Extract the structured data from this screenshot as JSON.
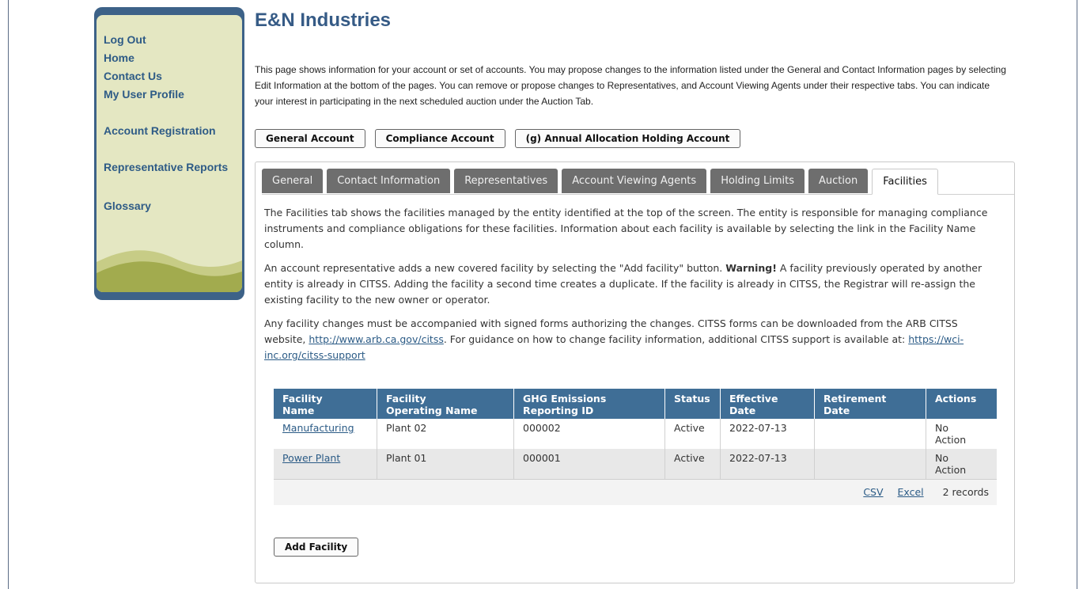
{
  "sidebar": {
    "links": [
      "Log Out",
      "Home",
      "Contact Us",
      "My User Profile"
    ],
    "account_registration": "Account Registration",
    "representative_reports": "Representative Reports",
    "glossary": "Glossary"
  },
  "main": {
    "title": "E&N Industries",
    "intro": "This page shows information for your account or set of accounts. You may propose changes to the information listed under the General and Contact Information pages by selecting Edit Information at the bottom of the pages. You can remove or propose changes to Representatives, and Account Viewing Agents under their respective tabs. You can indicate your interest in participating in the next scheduled auction under the Auction Tab.",
    "account_buttons": [
      "General Account",
      "Compliance Account",
      "(g) Annual Allocation Holding Account"
    ]
  },
  "tabs": [
    "General",
    "Contact Information",
    "Representatives",
    "Account Viewing Agents",
    "Holding Limits",
    "Auction",
    "Facilities"
  ],
  "active_tab": "Facilities",
  "facilities": {
    "p1": "The Facilities tab shows the facilities managed by the entity identified at the top of the screen. The entity is responsible for managing compliance instruments and compliance obligations for these facilities. Information about each facility is available by selecting the link in the Facility Name column.",
    "p2_a": "An account representative adds a new covered facility by selecting the \"Add facility\" button. ",
    "p2_warning": "Warning!",
    "p2_b": " A facility previously operated by another entity is already in CITSS. Adding the facility a second time creates a duplicate. If the facility is already in CITSS, the Registrar will re-assign the existing facility to the new owner or operator.",
    "p3_a": "Any facility changes must be accompanied with signed forms authorizing the changes. CITSS forms can be downloaded from the ARB CITSS website, ",
    "p3_link1": "http://www.arb.ca.gov/citss",
    "p3_b": ". For guidance on how to change facility information, additional CITSS support is available at: ",
    "p3_link2": "https://wci-inc.org/citss-support",
    "table": {
      "headers": [
        [
          "Facility",
          "Name"
        ],
        [
          "Facility",
          "Operating Name"
        ],
        [
          "GHG Emissions",
          "Reporting ID"
        ],
        [
          "Status",
          ""
        ],
        [
          "Effective",
          "Date"
        ],
        [
          "Retirement",
          "Date"
        ],
        [
          "Actions",
          ""
        ]
      ],
      "rows": [
        {
          "name": "Manufacturing",
          "operating_name": "Plant 02",
          "ghg_id": "000002",
          "status": "Active",
          "effective": "2022-07-13",
          "retirement": "",
          "action1": "No",
          "action2": "Action"
        },
        {
          "name": "Power Plant",
          "operating_name": "Plant 01",
          "ghg_id": "000001",
          "status": "Active",
          "effective": "2022-07-13",
          "retirement": "",
          "action1": "No",
          "action2": "Action"
        }
      ],
      "footer": {
        "csv": "CSV",
        "excel": "Excel",
        "records": "2 records"
      }
    },
    "add_button": "Add Facility"
  },
  "colors": {
    "sidebar_border": "#3d6288",
    "sidebar_bg": "#e4e7c2",
    "link": "#2e5b86",
    "table_header": "#3f6e96",
    "tab_inactive": "#6e6e6e"
  }
}
